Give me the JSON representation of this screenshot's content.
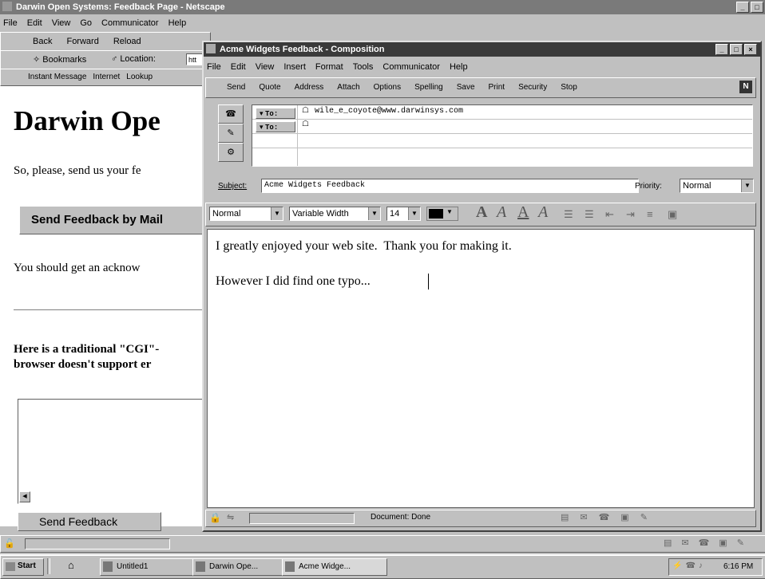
{
  "browser": {
    "title": "Darwin Open Systems: Feedback Page - Netscape",
    "menu": [
      "File",
      "Edit",
      "View",
      "Go",
      "Communicator",
      "Help"
    ],
    "nav": [
      "Back",
      "Forward",
      "Reload"
    ],
    "bookmarks_label": "Bookmarks",
    "location_label": "Location:",
    "location_value": "htt",
    "personal": [
      "Instant Message",
      "Internet",
      "Lookup"
    ],
    "page": {
      "heading": "Darwin Ope",
      "intro": "So, please, send us your fe",
      "send_mail_button": "Send Feedback by Mail",
      "ack_text": "You should get an acknow",
      "cgi_line1": "Here is a traditional \"CGI\"-",
      "cgi_line2": "browser doesn't support er",
      "send_feedback_button": "Send Feedback"
    }
  },
  "compose": {
    "title": "Acme Widgets Feedback - Composition",
    "menu": [
      "File",
      "Edit",
      "View",
      "Insert",
      "Format",
      "Tools",
      "Communicator",
      "Help"
    ],
    "toolbar": [
      "Send",
      "Quote",
      "Address",
      "Attach",
      "Options",
      "Spelling",
      "Save",
      "Print",
      "Security",
      "Stop"
    ],
    "to_label": "To:",
    "to_value": "wile_e_coyote@www.darwinsys.com",
    "subject_label": "Subject:",
    "subject_value": "Acme Widgets Feedback",
    "priority_label": "Priority:",
    "priority_value": "Normal",
    "format_style": "Normal",
    "font_face": "Variable Width",
    "font_size": "14",
    "body_line1": "I greatly enjoyed your web site.  Thank you for making it.",
    "body_line2": "However I did find one typo...",
    "status": "Document: Done"
  },
  "taskbar": {
    "start": "Start",
    "tasks": [
      "Untitled1",
      "Darwin Ope...",
      "Acme Widge..."
    ],
    "clock": "6:16 PM"
  }
}
